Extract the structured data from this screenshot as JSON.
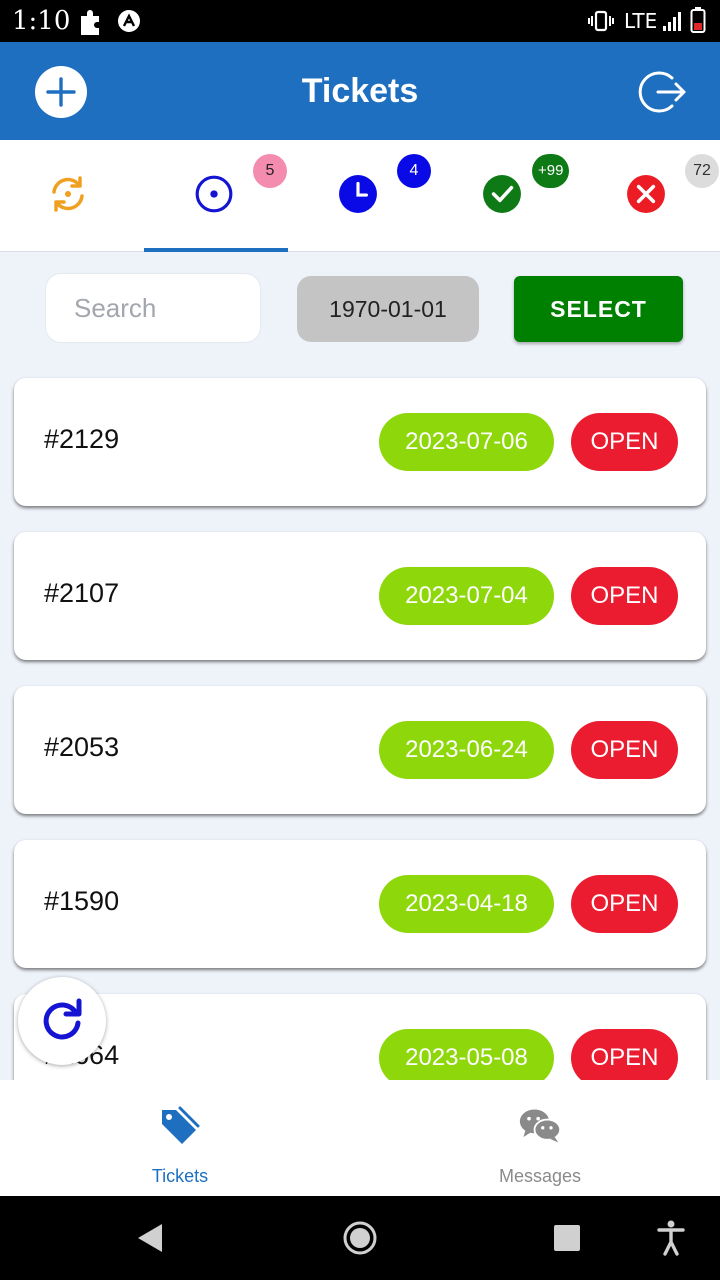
{
  "status_bar": {
    "time": "1:10",
    "network": "LTE"
  },
  "app_bar": {
    "title": "Tickets"
  },
  "tabs": [
    {
      "name": "all",
      "icon": "sync-icon",
      "color": "#f0a020",
      "badge": ""
    },
    {
      "name": "open",
      "icon": "radio-target-icon",
      "color": "#1414d2",
      "badge": "5",
      "badge_color": "#f48cb0",
      "selected": true
    },
    {
      "name": "pending",
      "icon": "clock-icon",
      "color": "#0a0ae6",
      "badge": "4",
      "badge_color": "#0a0ae6"
    },
    {
      "name": "closed",
      "icon": "check-icon",
      "color": "#0e7a16",
      "badge": "+99",
      "badge_color": "#0e7a16"
    },
    {
      "name": "cancelled",
      "icon": "x-icon",
      "color": "#ec1c24",
      "badge": "72",
      "badge_color": "#dcdcdc"
    }
  ],
  "filters": {
    "search_placeholder": "Search",
    "date": "1970-01-01",
    "select_label": "SELECT"
  },
  "tickets": [
    {
      "id": "#2129",
      "date": "2023-07-06",
      "status": "OPEN"
    },
    {
      "id": "#2107",
      "date": "2023-07-04",
      "status": "OPEN"
    },
    {
      "id": "#2053",
      "date": "2023-06-24",
      "status": "OPEN"
    },
    {
      "id": "#1590",
      "date": "2023-04-18",
      "status": "OPEN"
    },
    {
      "id": "#1664",
      "date": "2023-05-08",
      "status": "OPEN"
    }
  ],
  "bottom_nav": [
    {
      "label": "Tickets",
      "icon": "tag-icon",
      "active": true
    },
    {
      "label": "Messages",
      "icon": "chat-icon",
      "active": false
    }
  ],
  "colors": {
    "primary": "#1f6fc0",
    "date_pill": "#8ed70a",
    "open_pill": "#ec1c30",
    "select_button": "#008000"
  }
}
